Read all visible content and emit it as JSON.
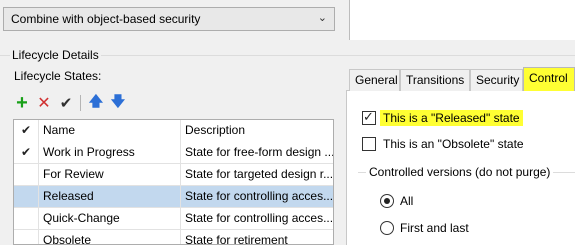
{
  "security_combo": {
    "value": "Combine with object-based security"
  },
  "lifecycle_details": {
    "title": "Lifecycle Details",
    "states_label": "Lifecycle States:"
  },
  "toolbar": [
    "add-icon",
    "delete-icon",
    "checkmark-icon",
    "arrow-up-icon",
    "arrow-down-icon"
  ],
  "table": {
    "header_check": "✔",
    "headers": {
      "name": "Name",
      "description": "Description"
    },
    "rows": [
      {
        "check": "✔",
        "name": "Work in Progress",
        "description": "State for free-form design ...",
        "selected": false
      },
      {
        "check": "",
        "name": "For Review",
        "description": "State for targeted design r...",
        "selected": false
      },
      {
        "check": "",
        "name": "Released",
        "description": "State for controlling acces...",
        "selected": true
      },
      {
        "check": "",
        "name": "Quick-Change",
        "description": "State for controlling acces...",
        "selected": false
      },
      {
        "check": "",
        "name": "Obsolete",
        "description": "State for retirement",
        "selected": false
      }
    ]
  },
  "tabs": [
    {
      "label": "General",
      "active": false
    },
    {
      "label": "Transitions",
      "active": false
    },
    {
      "label": "Security",
      "active": false
    },
    {
      "label": "Control",
      "active": true
    }
  ],
  "control_tab": {
    "released_label": "This is a \"Released\" state",
    "released_checked": true,
    "obsolete_label": "This is an \"Obsolete\" state",
    "obsolete_checked": false,
    "controlled_versions_title": "Controlled versions (do not purge)",
    "option_all": "All",
    "option_first_last": "First and last",
    "selected_option": "All"
  },
  "colors": {
    "highlight": "#ffff33",
    "selected_row": "#c2d8ee",
    "add_icon": "#18a018",
    "delete_icon": "#d03030",
    "arrow_icon": "#2c6fd6"
  }
}
